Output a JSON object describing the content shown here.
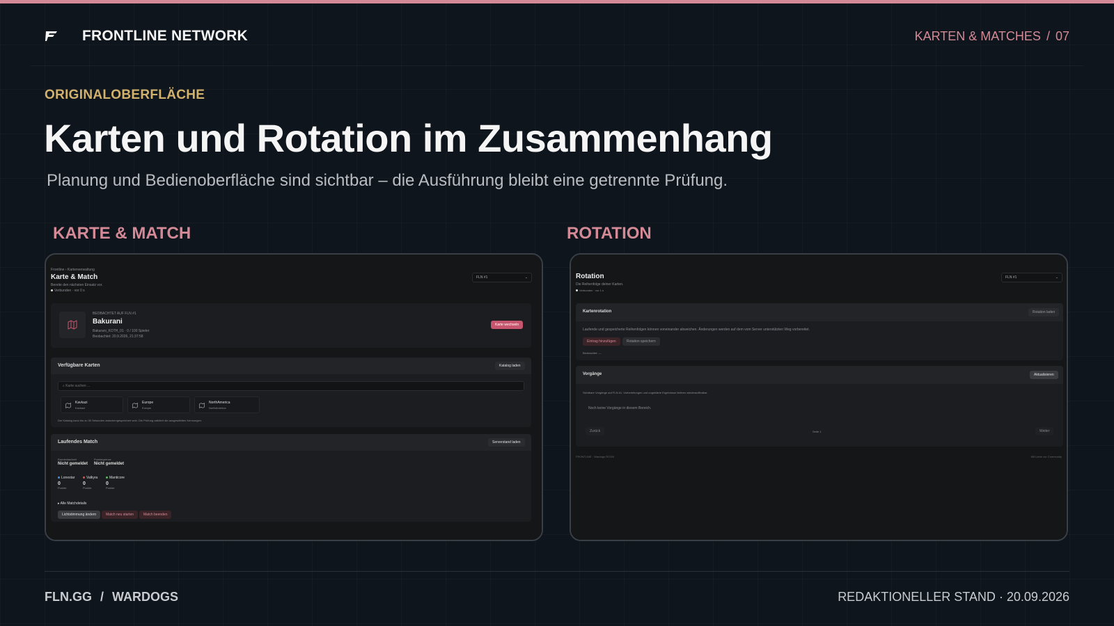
{
  "header": {
    "brand": "FRONTLINE NETWORK",
    "section": "KARTEN & MATCHES",
    "separator": "/",
    "page": "07"
  },
  "eyebrow": "ORIGINALOBERFLÄCHE",
  "title": "Karten und Rotation im Zusammenhang",
  "subtitle": "Planung und Bedienoberfläche sind sichtbar – die Ausführung bleibt eine getrennte Prüfung.",
  "panels": {
    "left_label": "KARTE & MATCH",
    "right_label": "ROTATION"
  },
  "map_ui": {
    "breadcrumb": "Frontline  ›  Kartenverwaltung",
    "title": "Karte & Match",
    "subtitle": "Bereite den nächsten Einsatz vor.",
    "status": "Verbunden · vor 0 s",
    "server_select": "FLN #1",
    "observed_label": "BEOBACHTET AUF FLN #1",
    "current_map": "Bakurani",
    "map_details": "Bakurani_KOTH_01 · 0 / 100 Spieler",
    "observed_time": "Beobachtet: 20.9.2026, 21:37:58",
    "change_map_button": "Karte wechseln",
    "available_title": "Verfügbare Karten",
    "load_catalog_button": "Katalog laden",
    "search_placeholder": "Karte suchen ...",
    "maps": [
      {
        "name": "Kavkazi",
        "sub": "Kavkazi"
      },
      {
        "name": "Europe",
        "sub": "Europe"
      },
      {
        "name": "NorthAmerica",
        "sub": "NorthAmerica"
      }
    ],
    "catalog_note": "Der Katalog kann bis zu 30 Sekunden zwischengespeichert sein. Die Prüfung validiert die ausgewählten Kennungen.",
    "match_title": "Laufendes Match",
    "load_server_button": "Serverstand laden",
    "round_label": "Rundenlaufzeit",
    "round_value": "Nicht gemeldet",
    "score_label": "Punktegrenze",
    "score_value": "Nicht gemeldet",
    "factions": [
      {
        "name": "Lonestar",
        "score": "0",
        "unit": "Punkte",
        "color": "#4a90d9"
      },
      {
        "name": "Valkyra",
        "score": "0",
        "unit": "Punkte",
        "color": "#d9534f"
      },
      {
        "name": "Manticore",
        "score": "0",
        "unit": "Punkte",
        "color": "#5cb85c"
      }
    ],
    "details_toggle": "▸ Alle Matchdetails",
    "light_button": "Lichtstimmung ändern",
    "restart_button": "Match neu starten",
    "end_button": "Match beenden"
  },
  "rotation_ui": {
    "title": "Rotation",
    "subtitle": "Die Reihenfolge deiner Karten.",
    "status": "Verbunden · vor 1 s",
    "server_select": "FLN #1",
    "rotation_title": "Kartenrotation",
    "load_rotation_button": "Rotation laden",
    "rotation_note": "Laufende und gespeicherte Reihenfolgen können voneinander abweichen. Änderungen werden auf dem vom Server unterstützten Weg vorbereitet.",
    "add_entry_button": "Eintrag hinzufügen",
    "save_rotation_button": "Rotation speichern",
    "observed": "Beobachtet: —",
    "processes_title": "Vorgänge",
    "refresh_button": "Aktualisieren",
    "processes_note": "Sichtbare Vorgänge auf FLN #1. Vorbereitungen und ungeklärte Ergebnisse bleiben wiederauffindbar.",
    "empty_state": "Noch keine Vorgänge in diesem Bereich.",
    "back_button": "Zurück",
    "page_indicator": "Seite 1",
    "next_button": "Weiter",
    "footer_left": "FRONTLINE  ·  Wardogs RCON",
    "footer_right": "Mit Liebe zur Community"
  },
  "footer": {
    "left_a": "FLN.GG",
    "left_sep": "/",
    "left_b": "WARDOGS",
    "right": "REDAKTIONELLER STAND · 20.09.2026"
  },
  "colors": {
    "accent": "#d48a96",
    "eyebrow": "#d1b16c",
    "background": "#0f151c"
  }
}
